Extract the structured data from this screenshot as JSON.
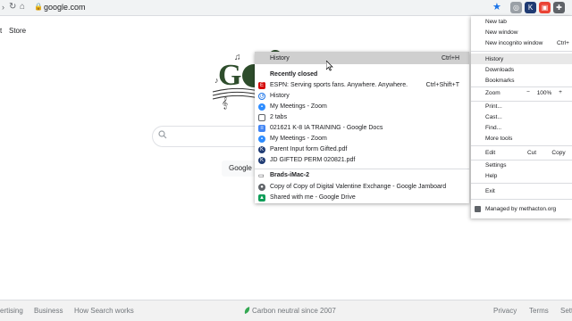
{
  "browser": {
    "url": "google.com"
  },
  "page": {
    "left_cut_text": "t",
    "store_link": "Store",
    "google_search_btn": "Google",
    "footer": {
      "advertising": "ertising",
      "business": "Business",
      "how_search_works": "How Search works",
      "carbon": "Carbon neutral since 2007",
      "privacy": "Privacy",
      "terms": "Terms",
      "settings": "Sett"
    }
  },
  "history_submenu": {
    "header": {
      "label": "History",
      "shortcut": "Ctrl+H"
    },
    "recently_closed_title": "Recently closed",
    "recent": [
      {
        "label": "ESPN: Serving sports fans. Anywhere. Anywhere.",
        "shortcut": "Ctrl+Shift+T",
        "icon": "espn-icon",
        "color": "#d50a0a"
      },
      {
        "label": "History",
        "shortcut": "",
        "icon": "history-icon",
        "color": "#1a73e8"
      },
      {
        "label": "My Meetings - Zoom",
        "shortcut": "",
        "icon": "zoom-icon",
        "color": "#2d8cff"
      },
      {
        "label": "2 tabs",
        "shortcut": "",
        "icon": "tabs-icon",
        "color": "#5f6368"
      },
      {
        "label": "021621 K-8 IA TRAINING - Google Docs",
        "shortcut": "",
        "icon": "docs-icon",
        "color": "#4285f4"
      },
      {
        "label": "My Meetings - Zoom",
        "shortcut": "",
        "icon": "zoom-icon",
        "color": "#2d8cff"
      },
      {
        "label": "Parent Input form Gifted.pdf",
        "shortcut": "",
        "icon": "k-icon",
        "color": "#1f3b73"
      },
      {
        "label": "JD GIFTED PERM 020821.pdf",
        "shortcut": "",
        "icon": "k-icon",
        "color": "#1f3b73"
      }
    ],
    "device_title": "Brads-iMac-2",
    "device": [
      {
        "label": "Copy of Copy of Digital Valentine Exchange - Google Jamboard",
        "icon": "jamboard-icon",
        "color": "#5f6368"
      },
      {
        "label": "Shared with me - Google Drive",
        "icon": "drive-icon",
        "color": "#0f9d58"
      }
    ]
  },
  "chrome_menu": {
    "new_tab": "New tab",
    "new_window": "New window",
    "new_incognito": "New incognito window",
    "incognito_shortcut": "Ctrl+",
    "history": "History",
    "downloads": "Downloads",
    "bookmarks": "Bookmarks",
    "zoom_label": "Zoom",
    "zoom_minus": "−",
    "zoom_value": "100%",
    "zoom_plus": "+",
    "print": "Print...",
    "cast": "Cast...",
    "find": "Find...",
    "more_tools": "More tools",
    "edit_label": "Edit",
    "cut": "Cut",
    "copy": "Copy",
    "settings": "Settings",
    "help": "Help",
    "exit": "Exit",
    "managed": "Managed by methacton.org"
  },
  "colors": {
    "accent": "#1a73e8",
    "doodle_green": "#2e4d2c"
  }
}
